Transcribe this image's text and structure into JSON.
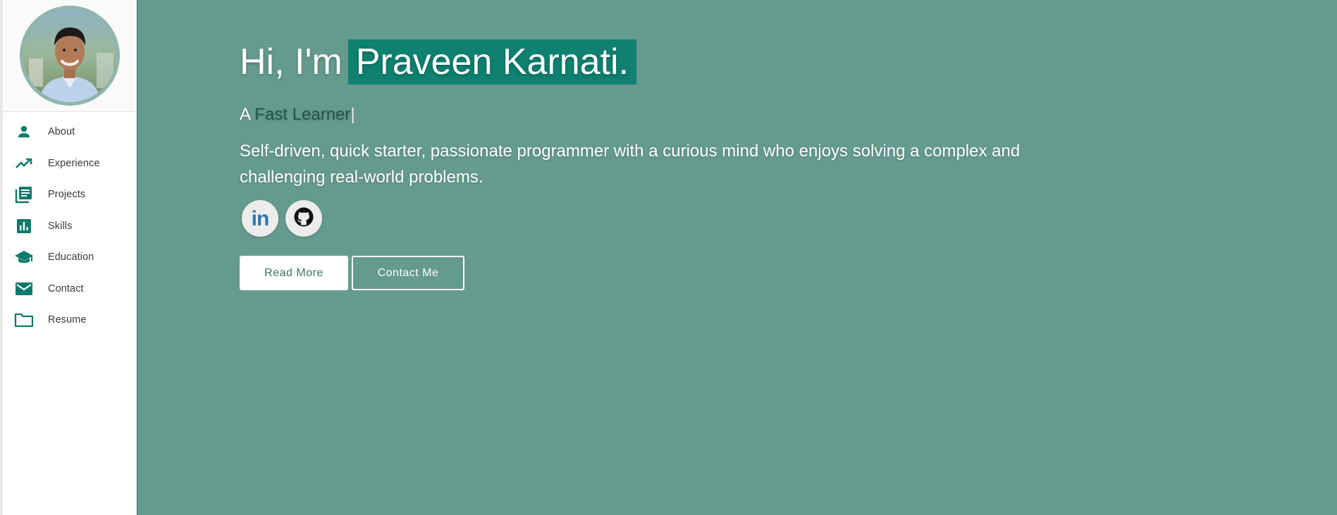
{
  "sidebar": {
    "avatar_alt": "profile photo",
    "items": [
      {
        "label": "About",
        "icon": "person-icon"
      },
      {
        "label": "Experience",
        "icon": "trending-up-icon"
      },
      {
        "label": "Projects",
        "icon": "library-books-icon"
      },
      {
        "label": "Skills",
        "icon": "bar-chart-icon"
      },
      {
        "label": "Education",
        "icon": "school-icon"
      },
      {
        "label": "Contact",
        "icon": "mail-icon"
      },
      {
        "label": "Resume",
        "icon": "folder-icon"
      }
    ]
  },
  "hero": {
    "greeting": "Hi, I'm",
    "name": "Praveen Karnati.",
    "tagline_prefix": "A",
    "tagline_typed": "Fast Learner",
    "tagline_cursor": "|",
    "bio": "Self-driven, quick starter, passionate programmer with a curious mind who enjoys solving a complex and challenging real-world problems.",
    "socials": [
      {
        "name": "LinkedIn",
        "icon": "linkedin-icon",
        "text": "in"
      },
      {
        "name": "GitHub",
        "icon": "github-icon"
      }
    ],
    "read_more_label": "Read More",
    "contact_label": "Contact Me"
  },
  "colors": {
    "background": "#659b8d",
    "accent": "#0f8170",
    "icon": "#0f7a6b",
    "typed_text": "#22574d"
  }
}
